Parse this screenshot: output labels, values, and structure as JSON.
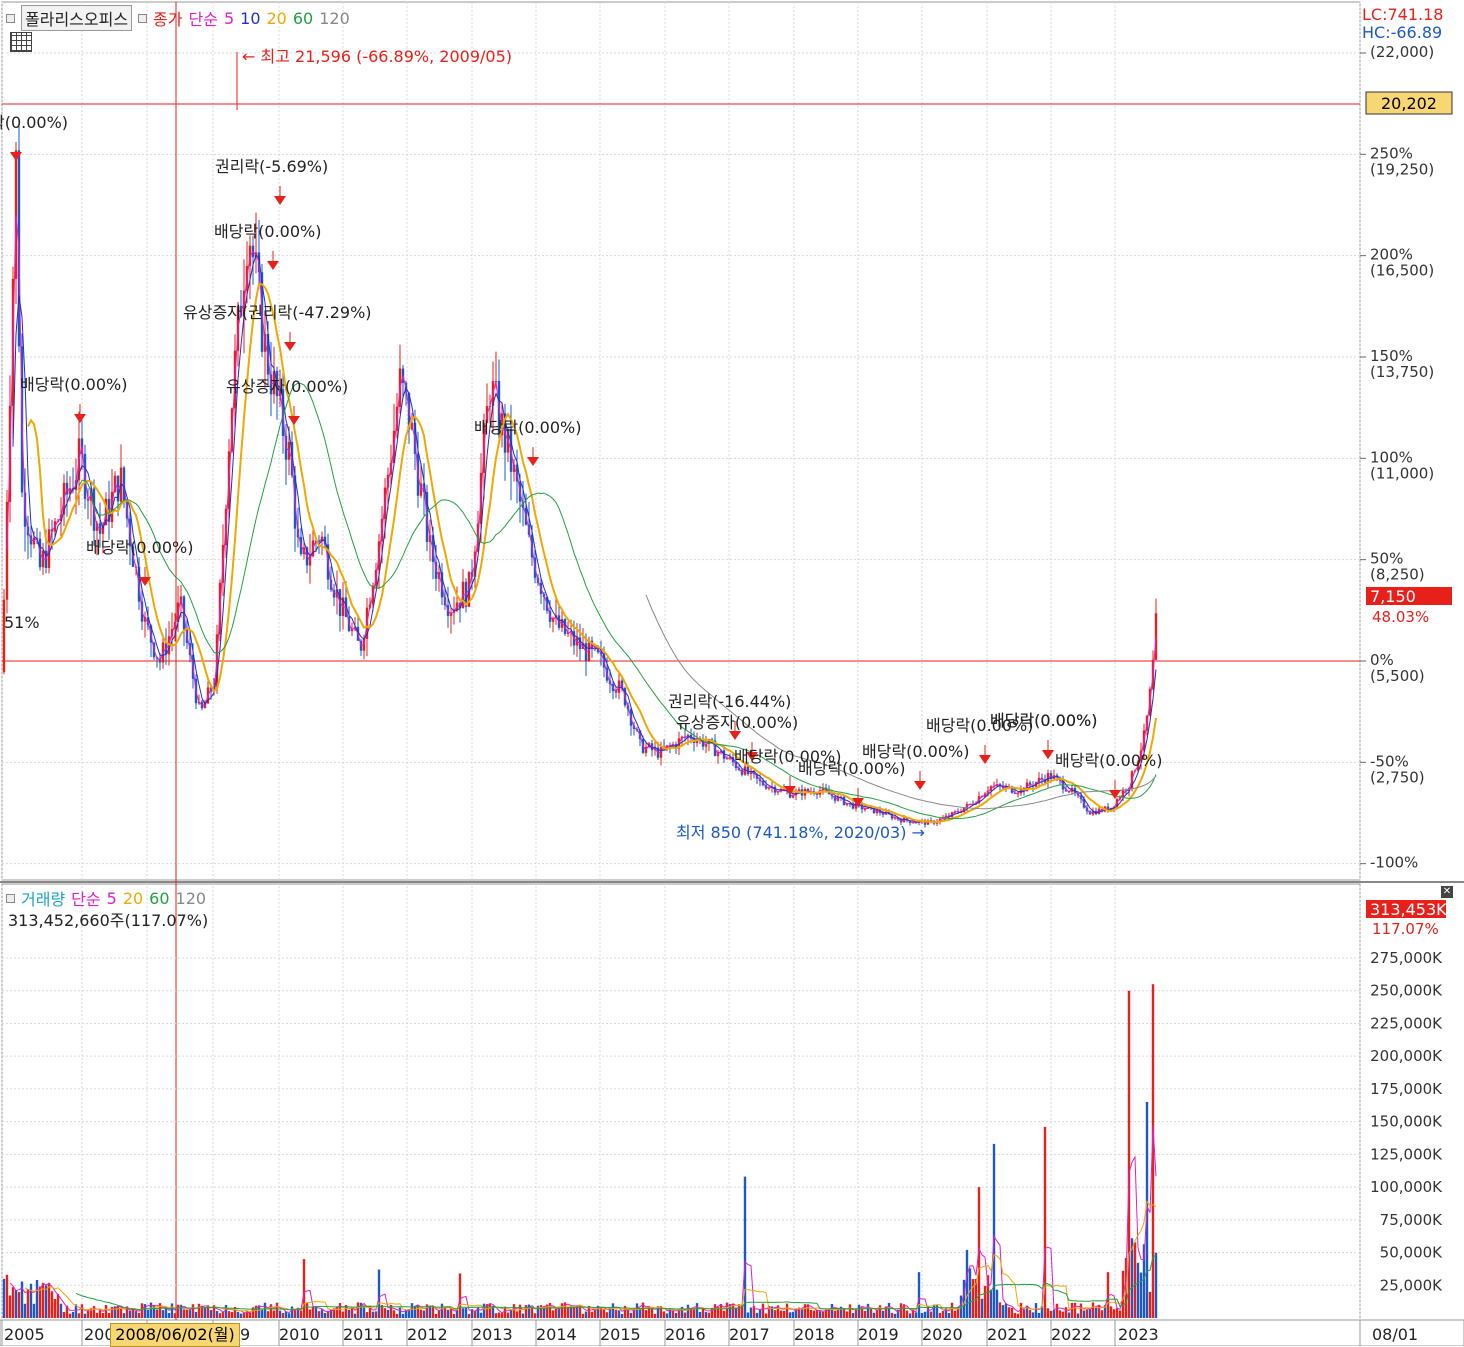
{
  "main_legend": {
    "name": "폴라리스오피스",
    "close": "종가",
    "ma_label": "단순",
    "periods": [
      "5",
      "10",
      "20",
      "60",
      "120"
    ]
  },
  "vol_legend": {
    "name": "거래량",
    "ma_label": "단순",
    "periods": [
      "5",
      "20",
      "60",
      "120"
    ]
  },
  "vol_info": "313,452,660주(117.07%)",
  "lc": "LC:741.18",
  "hc": "HC:-66.89",
  "date_cursor": "2008/06/02(월)",
  "colors": {
    "up": "#e8201a",
    "down": "#1c58c8",
    "ma5": "#e020c8",
    "ma10": "#2030c0",
    "ma20": "#f0a800",
    "ma60": "#20a040",
    "ma120": "#888888",
    "grid": "#d8d8d8",
    "current_box": "#e8201a",
    "hline_box": "#f7d774"
  },
  "chart_data": {
    "type": "candlestick",
    "x_axis_labels": [
      "2005",
      "200",
      "9",
      "2010",
      "2011",
      "2012",
      "2013",
      "2014",
      "2015",
      "2016",
      "2017",
      "2018",
      "2019",
      "2020",
      "2021",
      "2022",
      "2023",
      "08/01"
    ],
    "price_axis": [
      {
        "pct": "",
        "price": "(22,000)"
      },
      {
        "pct": "250%",
        "price": "(19,250)"
      },
      {
        "pct": "200%",
        "price": "(16,500)"
      },
      {
        "pct": "150%",
        "price": "(13,750)"
      },
      {
        "pct": "100%",
        "price": "(11,000)"
      },
      {
        "pct": "50%",
        "price": "(8,250)"
      },
      {
        "pct": "0%",
        "price": "(5,500)"
      },
      {
        "pct": "-50%",
        "price": "(2,750)"
      },
      {
        "pct": "-100%",
        "price": ""
      }
    ],
    "hline_price": "20,202",
    "current_price": "7,150",
    "current_pct": "48.03%",
    "high_note": "최고 21,596 (-66.89%, 2009/05)",
    "low_note": "최저 850 (741.18%, 2020/03)",
    "annotations": [
      {
        "text": "락(0.00%)"
      },
      {
        "text": "권리락(-5.69%)"
      },
      {
        "text": "배당락(0.00%)"
      },
      {
        "text": "유상증자(권리락(-47.29%)"
      },
      {
        "text": "배당락(0.00%)"
      },
      {
        "text": "유상증자(0.00%)"
      },
      {
        "text": "배당락(0.00%)"
      },
      {
        "text": "배당락(0.00%)"
      },
      {
        "text": "51%"
      },
      {
        "text": "권리락(-16.44%)"
      },
      {
        "text": "유상증자(0.00%)"
      },
      {
        "text": "배당락(0.00%)"
      },
      {
        "text": "배당락(0.00%)"
      },
      {
        "text": "배당락(0.00%)"
      },
      {
        "text": "배당락(0.00%)"
      },
      {
        "text": "배당락(0.00%)"
      },
      {
        "text": "배당락(0.00%)"
      },
      {
        "text": "배당락(0.00%)"
      }
    ],
    "volume_axis": [
      "275,000K",
      "250,000K",
      "225,000K",
      "200,000K",
      "175,000K",
      "150,000K",
      "125,000K",
      "100,000K",
      "75,000K",
      "50,000K",
      "25,000K"
    ],
    "volume_current": "313,453K",
    "volume_pct": "117.07%"
  }
}
